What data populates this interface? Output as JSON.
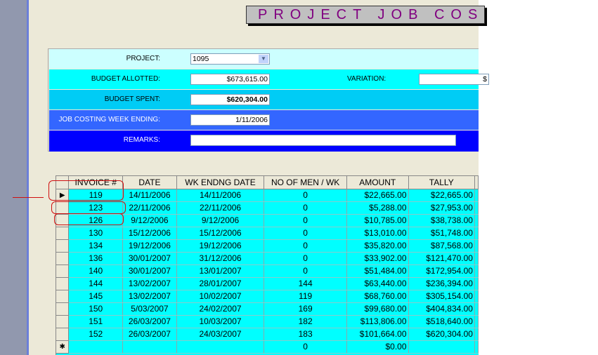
{
  "title": "PROJECT JOB COS",
  "form": {
    "project": {
      "label": "PROJECT:",
      "value": "1095"
    },
    "budget_allotted": {
      "label": "BUDGET ALLOTTED:",
      "value": "$673,615.00"
    },
    "variation": {
      "label": "VARIATION:",
      "value": "$"
    },
    "budget_spent": {
      "label": "BUDGET SPENT:",
      "value": "$620,304.00"
    },
    "week_ending": {
      "label": "JOB COSTING WEEK ENDING:",
      "value": "1/11/2006"
    },
    "remarks": {
      "label": "REMARKS:",
      "value": ""
    }
  },
  "grid": {
    "headers": [
      "INVOICE #",
      "DATE",
      "WK ENDNG DATE",
      "NO OF MEN / WK",
      "AMOUNT",
      "TALLY"
    ],
    "rows": [
      [
        "119",
        "14/11/2006",
        "14/11/2006",
        "0",
        "$22,665.00",
        "$22,665.00"
      ],
      [
        "123",
        "22/11/2006",
        "22/11/2006",
        "0",
        "$5,288.00",
        "$27,953.00"
      ],
      [
        "126",
        "9/12/2006",
        "9/12/2006",
        "0",
        "$10,785.00",
        "$38,738.00"
      ],
      [
        "130",
        "15/12/2006",
        "15/12/2006",
        "0",
        "$13,010.00",
        "$51,748.00"
      ],
      [
        "134",
        "19/12/2006",
        "19/12/2006",
        "0",
        "$35,820.00",
        "$87,568.00"
      ],
      [
        "136",
        "30/01/2007",
        "31/12/2006",
        "0",
        "$33,902.00",
        "$121,470.00"
      ],
      [
        "140",
        "30/01/2007",
        "13/01/2007",
        "0",
        "$51,484.00",
        "$172,954.00"
      ],
      [
        "144",
        "13/02/2007",
        "28/01/2007",
        "144",
        "$63,440.00",
        "$236,394.00"
      ],
      [
        "145",
        "13/02/2007",
        "10/02/2007",
        "119",
        "$68,760.00",
        "$305,154.00"
      ],
      [
        "150",
        "5/03/2007",
        "24/02/2007",
        "169",
        "$99,680.00",
        "$404,834.00"
      ],
      [
        "151",
        "26/03/2007",
        "10/03/2007",
        "182",
        "$113,806.00",
        "$518,640.00"
      ],
      [
        "152",
        "26/03/2007",
        "24/03/2007",
        "183",
        "$101,664.00",
        "$620,304.00"
      ]
    ],
    "new_row": [
      "",
      "",
      "",
      "0",
      "$0.00",
      ""
    ],
    "current_marker": "▶",
    "new_marker": "✱"
  },
  "colors": {
    "row1": "#ccffff",
    "row2": "#00ffff",
    "row3": "#00ccf5",
    "row4": "#3366ff",
    "row5": "#0000ff",
    "title_text": "#800080"
  }
}
